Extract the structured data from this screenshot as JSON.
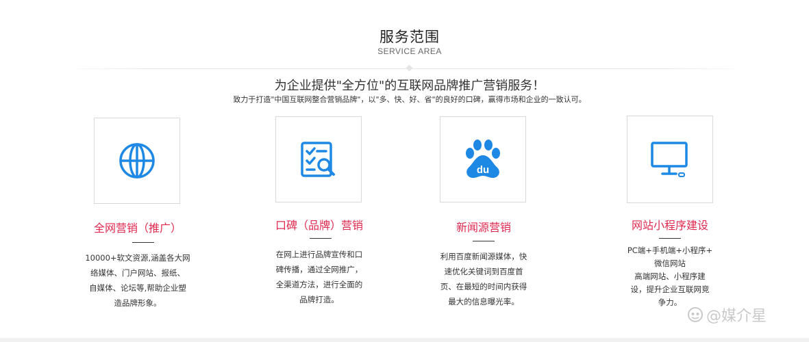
{
  "section": {
    "title": "服务范围",
    "subtitle": "SERVICE AREA"
  },
  "intro": {
    "headline": "为企业提供\"全方位\"的互联网品牌推广营销服务！",
    "subline": "致力于打造\"中国互联网整合营销品牌\"，以\"多、快、好、省\"的良好的口碑，赢得市场和企业的一致认可。"
  },
  "services": [
    {
      "icon": "globe-icon",
      "title": "全网营销（推广）",
      "lines": [
        "10000+软文资源,涵盖各大网",
        "络媒体、门户网站、报纸、",
        "自媒体、论坛等,帮助企业塑",
        "造品牌形象。"
      ]
    },
    {
      "icon": "search-document-icon",
      "title": "口碑（品牌）营销",
      "lines": [
        "在网上进行品牌宣传和口",
        "碑传播，通过全网推广，",
        "全渠道方法，进行全面的",
        "品牌打造。"
      ]
    },
    {
      "icon": "baidu-paw-icon",
      "title": "新闻源营销",
      "lines": [
        "利用百度新闻源媒体，快",
        "速优化关键词到百度首",
        "页、在最短的时间内获得",
        "最大的信息曝光率。"
      ]
    },
    {
      "icon": "monitor-icon",
      "title": "网站小程序建设",
      "lines": [
        "PC端+手机端+小程序+",
        "微信网站",
        "高端网站、小程序建",
        "设，提升企业互联网竞",
        "争力。"
      ]
    }
  ],
  "watermark": {
    "text": "@媒介星"
  },
  "colors": {
    "accent_title": "#e0284f",
    "icon_blue": "#1e88e5",
    "border": "#d8d8d8"
  }
}
